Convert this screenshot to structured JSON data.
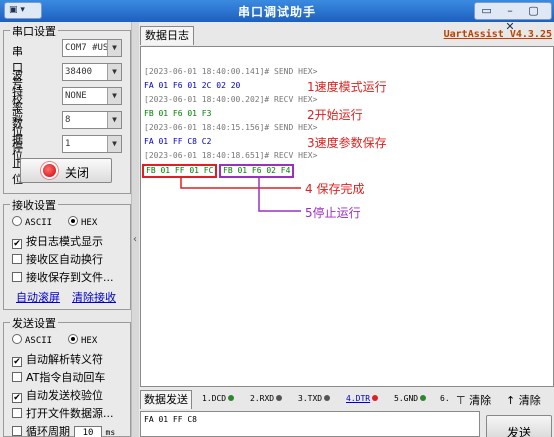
{
  "window": {
    "title": "串口调试助手",
    "menu_label": "▣ ▾",
    "sys_buttons": "▭ – ▢ ✕"
  },
  "serial_settings": {
    "group_title": "串口设置",
    "port": {
      "label": "串口号",
      "value": "COM7 #USI"
    },
    "baud": {
      "label": "波特率",
      "value": "38400"
    },
    "parity": {
      "label": "校验位",
      "value": "NONE"
    },
    "databits": {
      "label": "数据位",
      "value": "8"
    },
    "stopbits": {
      "label": "停止位",
      "value": "1"
    },
    "close_button": "关闭"
  },
  "receive_settings": {
    "group_title": "接收设置",
    "ascii": "ASCII",
    "hex": "HEX",
    "options": [
      {
        "label": "按日志模式显示",
        "checked": true
      },
      {
        "label": "接收区自动换行",
        "checked": false
      },
      {
        "label": "接收保存到文件...",
        "checked": false
      }
    ],
    "link_autoscroll": "自动滚屏",
    "link_clear": "清除接收"
  },
  "send_settings": {
    "group_title": "发送设置",
    "ascii": "ASCII",
    "hex": "HEX",
    "options": [
      {
        "label": "自动解析转义符",
        "checked": true
      },
      {
        "label": "AT指令自动回车",
        "checked": false
      },
      {
        "label": "自动发送校验位",
        "checked": true
      },
      {
        "label": "打开文件数据源...",
        "checked": false
      }
    ],
    "cycle": {
      "label": "循环周期",
      "value": "10",
      "unit": "ms"
    }
  },
  "log_panel": {
    "tab": "数据日志",
    "brand": "UartAssist V4.3.25",
    "lines": [
      {
        "ts": "[2023-06-01 18:40:00.141]# SEND HEX>",
        "data": "FA 01 F6 01 2C 02 20",
        "dir": "send"
      },
      {
        "ts": "[2023-06-01 18:40:00.202]# RECV HEX>",
        "data": "FB 01 F6 01 F3",
        "dir": "recv"
      },
      {
        "ts": "[2023-06-01 18:40:15.156]# SEND HEX>",
        "data": "FA 01 FF C8 C2",
        "dir": "send"
      },
      {
        "ts": "[2023-06-01 18:40:18.651]# RECV HEX>",
        "data": "FB 01 FF 01 FC",
        "data2": "FB 01 F6 02 F4",
        "dir": "recv"
      }
    ],
    "annotations": [
      "1速度模式运行",
      "2开始运行",
      "3速度参数保存",
      "4 保存完成",
      "5停止运行"
    ]
  },
  "send_panel": {
    "tab": "数据发送",
    "signals": [
      {
        "label": "1.DCD",
        "color": "#2a8a2a"
      },
      {
        "label": "2.RXD",
        "color": "#555555"
      },
      {
        "label": "3.TXD",
        "color": "#555555"
      },
      {
        "label": "4.DTR",
        "color": "#e02020"
      },
      {
        "label": "5.GND",
        "color": "#2a8a2a"
      },
      {
        "label": "6.",
        "color": ""
      }
    ],
    "clear1": "清除",
    "clear2": "清除",
    "input_value": "FA 01 FF C8",
    "send_button": "发送"
  },
  "colors": {
    "send": "#0000cc",
    "recv": "#008000",
    "annotation": "#e02020",
    "box_red": "#e02020",
    "box_purple": "#9b30c0"
  }
}
